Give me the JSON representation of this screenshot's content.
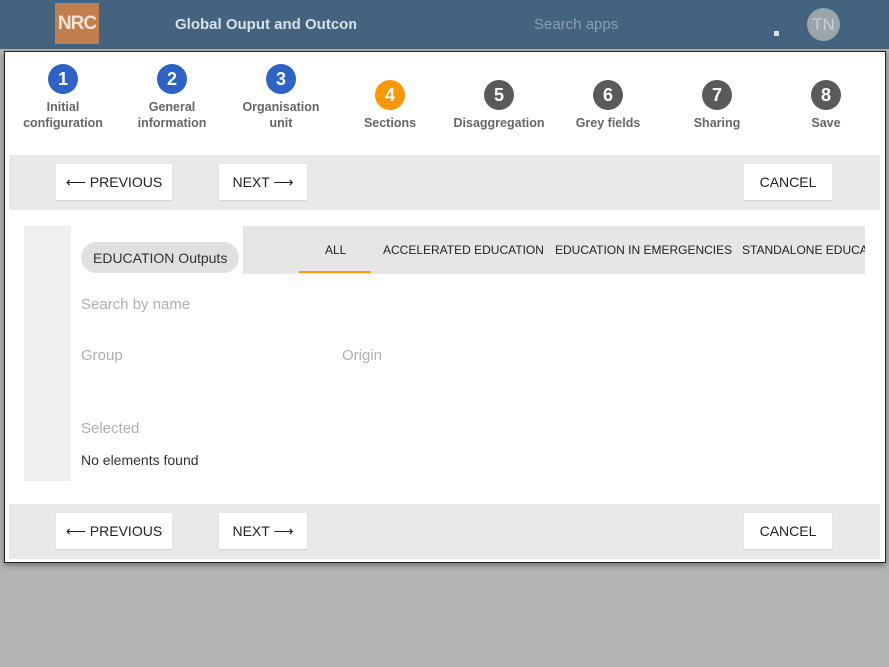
{
  "header": {
    "logo": "NRC",
    "title": "Global Ouput and Outcome",
    "search_placeholder": "Search apps",
    "avatar_initials": "TN"
  },
  "steps": [
    {
      "number": "1",
      "label_line1": "Initial",
      "label_line2": "configuration",
      "state": "completed"
    },
    {
      "number": "2",
      "label_line1": "General",
      "label_line2": "information",
      "state": "completed"
    },
    {
      "number": "3",
      "label_line1": "Organisation",
      "label_line2": "unit",
      "state": "completed"
    },
    {
      "number": "4",
      "label_line1": "",
      "label_line2": "Sections",
      "state": "active"
    },
    {
      "number": "5",
      "label_line1": "",
      "label_line2": "Disaggregation",
      "state": "pending"
    },
    {
      "number": "6",
      "label_line1": "",
      "label_line2": "Grey fields",
      "state": "pending"
    },
    {
      "number": "7",
      "label_line1": "",
      "label_line2": "Sharing",
      "state": "pending"
    },
    {
      "number": "8",
      "label_line1": "",
      "label_line2": "Save",
      "state": "pending"
    }
  ],
  "nav": {
    "previous": "⟵ PREVIOUS",
    "next": "NEXT ⟶",
    "cancel": "CANCEL"
  },
  "section": {
    "chip": "EDUCATION Outputs",
    "tabs": [
      "ALL",
      "ACCELERATED EDUCATION",
      "EDUCATION IN EMERGENCIES",
      "STANDALONE EDUCATION"
    ],
    "active_tab": "ALL",
    "search_placeholder": "Search by name",
    "group_label": "Group",
    "origin_label": "Origin",
    "selected_label": "Selected",
    "empty_message": "No elements found"
  },
  "colors": {
    "header_bg": "#44637f",
    "completed_step": "#2e62c4",
    "active_step": "#ff9800",
    "pending_step": "#5a5a5a"
  }
}
